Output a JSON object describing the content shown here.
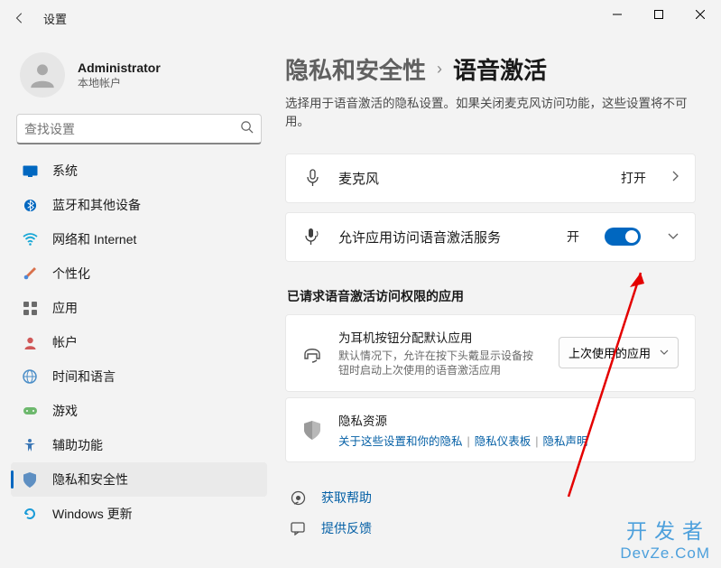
{
  "window": {
    "title": "设置"
  },
  "user": {
    "name": "Administrator",
    "subtitle": "本地帐户"
  },
  "search": {
    "placeholder": "查找设置"
  },
  "nav": {
    "items": [
      {
        "label": "系统"
      },
      {
        "label": "蓝牙和其他设备"
      },
      {
        "label": "网络和 Internet"
      },
      {
        "label": "个性化"
      },
      {
        "label": "应用"
      },
      {
        "label": "帐户"
      },
      {
        "label": "时间和语言"
      },
      {
        "label": "游戏"
      },
      {
        "label": "辅助功能"
      },
      {
        "label": "隐私和安全性"
      },
      {
        "label": "Windows 更新"
      }
    ]
  },
  "breadcrumb": {
    "parent": "隐私和安全性",
    "current": "语音激活"
  },
  "description": "选择用于语音激活的隐私设置。如果关闭麦克风访问功能，这些设置将不可用。",
  "mic_card": {
    "label": "麦克风",
    "state": "打开"
  },
  "service_card": {
    "label": "允许应用访问语音激活服务",
    "state": "开"
  },
  "apps_section": {
    "title": "已请求语音激活访问权限的应用",
    "headset": {
      "title": "为耳机按钮分配默认应用",
      "desc": "默认情况下，允许在按下头戴显示设备按钮时启动上次使用的语音激活应用",
      "dropdown": "上次使用的应用"
    },
    "privacy": {
      "title": "隐私资源",
      "link1": "关于这些设置和你的隐私",
      "link2": "隐私仪表板",
      "link3": "隐私声明"
    }
  },
  "help": {
    "get_help": "获取帮助",
    "feedback": "提供反馈"
  },
  "watermark": {
    "line1": "开发者",
    "line2": "DevZe.CoM"
  }
}
